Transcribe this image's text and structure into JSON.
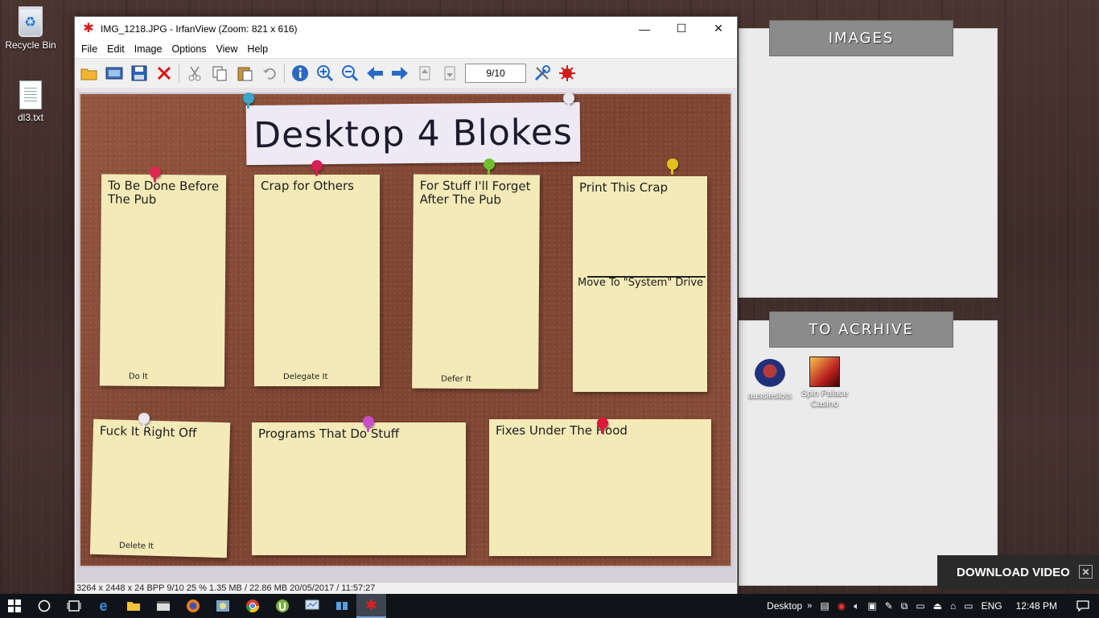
{
  "desktop": {
    "icons": [
      {
        "label": "Recycle Bin",
        "icon": "recycle-bin-icon"
      },
      {
        "label": "dl3.txt",
        "icon": "text-file-icon"
      }
    ]
  },
  "irfanview": {
    "title": "IMG_1218.JPG - IrfanView (Zoom: 821 x 616)",
    "menu": [
      "File",
      "Edit",
      "Image",
      "Options",
      "View",
      "Help"
    ],
    "page_counter": "9/10",
    "statusbar": "3264 x 2448 x 24 BPP    9/10    25 %    1.35 MB / 22.86 MB    20/05/2017 / 11:57:27",
    "photo": {
      "board_title": "Desktop 4 Blokes",
      "notes": [
        {
          "label": "To Be Done Before The Pub",
          "footer": "Do It"
        },
        {
          "label": "Crap for Others",
          "footer": "Delegate It"
        },
        {
          "label": "For Stuff I'll Forget After The Pub",
          "footer": "Defer It"
        },
        {
          "label": "Print This Crap",
          "footer": "",
          "extra": "Move To \"System\" Drive"
        },
        {
          "label": "Fuck It Right Off",
          "footer": "Delete It"
        },
        {
          "label": "Programs That Do Stuff",
          "footer": ""
        },
        {
          "label": "Fixes Under The Hood",
          "footer": ""
        }
      ]
    }
  },
  "fences": {
    "images": {
      "title": "IMAGES"
    },
    "archive": {
      "title": "TO ACRHIVE",
      "items": [
        {
          "label": "aussieslots"
        },
        {
          "label": "Spin Palace Casino"
        }
      ]
    }
  },
  "download_bar": {
    "label": "DOWNLOAD VIDEO"
  },
  "taskbar": {
    "desktop_label": "Desktop",
    "language": "ENG",
    "time": "12:48 PM"
  }
}
